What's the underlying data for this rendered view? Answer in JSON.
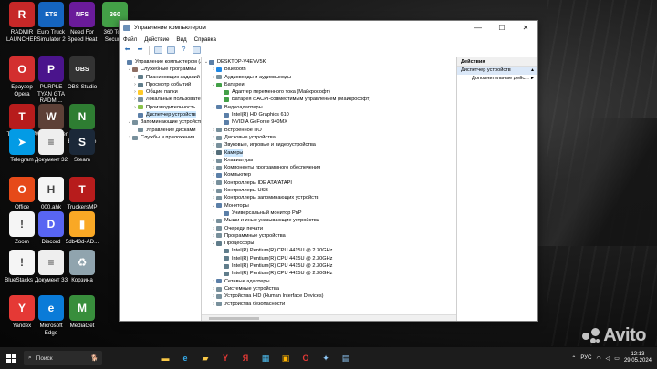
{
  "desktop_icons": [
    {
      "label": "RADMIR LAUNCHER",
      "color": "#c62828",
      "glyph": "R"
    },
    {
      "label": "Euro Truck Simulator 2",
      "color": "#1565c0",
      "glyph": "ETS"
    },
    {
      "label": "Need For Speed Heat",
      "color": "#6a1b9a",
      "glyph": "NFS"
    },
    {
      "label": "360 Total Security",
      "color": "#43a047",
      "glyph": "360"
    },
    {
      "label": "Браузер Opera",
      "color": "#d32f2f",
      "glyph": "O"
    },
    {
      "label": "PURPLE TYAN GTA RADMI...",
      "color": "#4a148c",
      "glyph": "P"
    },
    {
      "label": "OBS Studio",
      "color": "#333333",
      "glyph": "OBS"
    },
    {
      "label": "TruckersMP",
      "color": "#b71c1c",
      "glyph": "T"
    },
    {
      "label": "War Thunder",
      "color": "#5d4037",
      "glyph": "W"
    },
    {
      "label": "GeForce Experience",
      "color": "#2e7d32",
      "glyph": "N"
    },
    {
      "label": "Telegram",
      "color": "#039be5",
      "glyph": "➤"
    },
    {
      "label": "Документ 32",
      "color": "#eeeeee",
      "glyph": "≡"
    },
    {
      "label": "Steam",
      "color": "#1b2838",
      "glyph": "S"
    },
    {
      "label": "Office",
      "color": "#e64a19",
      "glyph": "O"
    },
    {
      "label": "000.ahk",
      "color": "#f5f5f5",
      "glyph": "H"
    },
    {
      "label": "TruckersMP",
      "color": "#b71c1c",
      "glyph": "T"
    },
    {
      "label": "Zoom",
      "color": "#f5f5f5",
      "glyph": "!"
    },
    {
      "label": "Discord",
      "color": "#5865f2",
      "glyph": "D"
    },
    {
      "label": "5db43d-AD...",
      "color": "#f9a825",
      "glyph": "▮"
    },
    {
      "label": "BlueStacks ...",
      "color": "#f5f5f5",
      "glyph": "!"
    },
    {
      "label": "Документ 33",
      "color": "#eeeeee",
      "glyph": "≡"
    },
    {
      "label": "Корзина",
      "color": "#90a4ae",
      "glyph": "♻"
    },
    {
      "label": "Yandex",
      "color": "#e53935",
      "glyph": "Y"
    },
    {
      "label": "Microsoft Edge",
      "color": "#0a7bd8",
      "glyph": "e"
    },
    {
      "label": "MediaGet",
      "color": "#388e3c",
      "glyph": "M"
    }
  ],
  "window": {
    "title": "Управление компьютером",
    "controls": {
      "minimize": "—",
      "maximize": "☐",
      "close": "✕"
    },
    "menu": [
      "Файл",
      "Действие",
      "Вид",
      "Справка"
    ],
    "toolbar": [
      "back-arrow-icon",
      "forward-arrow-icon",
      "folder-icon",
      "properties-icon",
      "help-icon",
      "view-icon"
    ],
    "left_tree": [
      {
        "text": "Управление компьютером (лс",
        "level": 0,
        "exp": "",
        "color": "#5b7fa8"
      },
      {
        "text": "Служебные программы",
        "level": 1,
        "exp": "⌄",
        "color": "#8d6e63"
      },
      {
        "text": "Планировщик заданий",
        "level": 2,
        "exp": "›",
        "color": "#607d8b"
      },
      {
        "text": "Просмотр событий",
        "level": 2,
        "exp": "›",
        "color": "#607d8b"
      },
      {
        "text": "Общие папки",
        "level": 2,
        "exp": "›",
        "color": "#ffca28"
      },
      {
        "text": "Локальные пользовате",
        "level": 2,
        "exp": "›",
        "color": "#78909c"
      },
      {
        "text": "Производительность",
        "level": 2,
        "exp": "›",
        "color": "#8bc34a"
      },
      {
        "text": "Диспетчер устройств",
        "level": 2,
        "exp": "",
        "color": "#5b7fa8",
        "selected": true
      },
      {
        "text": "Запоминающие устройства",
        "level": 1,
        "exp": "⌄",
        "color": "#78909c"
      },
      {
        "text": "Управление дисками",
        "level": 2,
        "exp": "",
        "color": "#78909c"
      },
      {
        "text": "Службы и приложения",
        "level": 1,
        "exp": "›",
        "color": "#78909c"
      }
    ],
    "device_tree": [
      {
        "text": "DESKTOP-V4EVV5K",
        "level": 0,
        "exp": "⌄",
        "color": "#5b7fa8"
      },
      {
        "text": "Bluetooth",
        "level": 1,
        "exp": "›",
        "color": "#1e88e5"
      },
      {
        "text": "Аудиовходы и аудиовыходы",
        "level": 1,
        "exp": "›",
        "color": "#78909c"
      },
      {
        "text": "Батареи",
        "level": 1,
        "exp": "⌄",
        "color": "#43a047"
      },
      {
        "text": "Адаптер переменного тока (Майкрософт)",
        "level": 2,
        "exp": "",
        "color": "#43a047"
      },
      {
        "text": "Батарея с ACPI-совместимым управлением (Майкрософт)",
        "level": 2,
        "exp": "",
        "color": "#43a047"
      },
      {
        "text": "Видеоадаптеры",
        "level": 1,
        "exp": "⌄",
        "color": "#5b7fa8"
      },
      {
        "text": "Intel(R) HD Graphics 610",
        "level": 2,
        "exp": "",
        "color": "#5b7fa8"
      },
      {
        "text": "NVIDIA GeForce 940MX",
        "level": 2,
        "exp": "",
        "color": "#5b7fa8"
      },
      {
        "text": "Встроенное ПО",
        "level": 1,
        "exp": "›",
        "color": "#78909c"
      },
      {
        "text": "Дисковые устройства",
        "level": 1,
        "exp": "›",
        "color": "#78909c"
      },
      {
        "text": "Звуковые, игровые и видеоустройства",
        "level": 1,
        "exp": "›",
        "color": "#78909c"
      },
      {
        "text": "Камеры",
        "level": 1,
        "exp": "›",
        "color": "#546e7a",
        "selected": true
      },
      {
        "text": "Клавиатуры",
        "level": 1,
        "exp": "›",
        "color": "#78909c"
      },
      {
        "text": "Компоненты программного обеспечения",
        "level": 1,
        "exp": "›",
        "color": "#78909c"
      },
      {
        "text": "Компьютер",
        "level": 1,
        "exp": "›",
        "color": "#5b7fa8"
      },
      {
        "text": "Контроллеры IDE ATA/ATAPI",
        "level": 1,
        "exp": "›",
        "color": "#78909c"
      },
      {
        "text": "Контроллеры USB",
        "level": 1,
        "exp": "›",
        "color": "#78909c"
      },
      {
        "text": "Контроллеры запоминающих устройств",
        "level": 1,
        "exp": "›",
        "color": "#78909c"
      },
      {
        "text": "Мониторы",
        "level": 1,
        "exp": "⌄",
        "color": "#5b7fa8"
      },
      {
        "text": "Универсальный монитор PnP",
        "level": 2,
        "exp": "",
        "color": "#5b7fa8"
      },
      {
        "text": "Мыши и иные указывающие устройства",
        "level": 1,
        "exp": "›",
        "color": "#78909c"
      },
      {
        "text": "Очереди печати",
        "level": 1,
        "exp": "›",
        "color": "#78909c"
      },
      {
        "text": "Программные устройства",
        "level": 1,
        "exp": "›",
        "color": "#78909c"
      },
      {
        "text": "Процессоры",
        "level": 1,
        "exp": "⌄",
        "color": "#607d8b"
      },
      {
        "text": "Intel(R) Pentium(R) CPU 4415U @ 2.30GHz",
        "level": 2,
        "exp": "",
        "color": "#607d8b"
      },
      {
        "text": "Intel(R) Pentium(R) CPU 4415U @ 2.30GHz",
        "level": 2,
        "exp": "",
        "color": "#607d8b"
      },
      {
        "text": "Intel(R) Pentium(R) CPU 4415U @ 2.30GHz",
        "level": 2,
        "exp": "",
        "color": "#607d8b"
      },
      {
        "text": "Intel(R) Pentium(R) CPU 4415U @ 2.30GHz",
        "level": 2,
        "exp": "",
        "color": "#607d8b"
      },
      {
        "text": "Сетевые адаптеры",
        "level": 1,
        "exp": "›",
        "color": "#5b7fa8"
      },
      {
        "text": "Системные устройства",
        "level": 1,
        "exp": "›",
        "color": "#78909c"
      },
      {
        "text": "Устройства HID (Human Interface Devices)",
        "level": 1,
        "exp": "›",
        "color": "#78909c"
      },
      {
        "text": "Устройства безопасности",
        "level": 1,
        "exp": "›",
        "color": "#78909c"
      }
    ],
    "actions": {
      "header": "Действия",
      "section": "Диспетчер устройств",
      "section_arrow": "▲",
      "item": "Дополнительные дейс...",
      "item_arrow": "►"
    }
  },
  "taskbar": {
    "search_placeholder": "Поиск",
    "apps": [
      {
        "icon": "file-explorer-icon",
        "glyph": "▬",
        "color": "#f9c846"
      },
      {
        "icon": "edge-icon",
        "glyph": "e",
        "color": "#35a9e8"
      },
      {
        "icon": "folder-icon",
        "glyph": "▰",
        "color": "#f9c846"
      },
      {
        "icon": "yandex-browser-icon",
        "glyph": "Y",
        "color": "#e53935"
      },
      {
        "icon": "yandex-icon",
        "glyph": "Я",
        "color": "#e53935"
      },
      {
        "icon": "store-icon",
        "glyph": "▦",
        "color": "#4fc3f7"
      },
      {
        "icon": "game-icon",
        "glyph": "▣",
        "color": "#ffb300"
      },
      {
        "icon": "opera-icon",
        "glyph": "O",
        "color": "#e53935"
      },
      {
        "icon": "settings-icon",
        "glyph": "✦",
        "color": "#90caf9"
      },
      {
        "icon": "computer-management-icon",
        "glyph": "▤",
        "color": "#90caf9"
      }
    ],
    "language": "РУС",
    "time": "12:13",
    "date": "29.05.2024"
  },
  "watermark": "Avito"
}
